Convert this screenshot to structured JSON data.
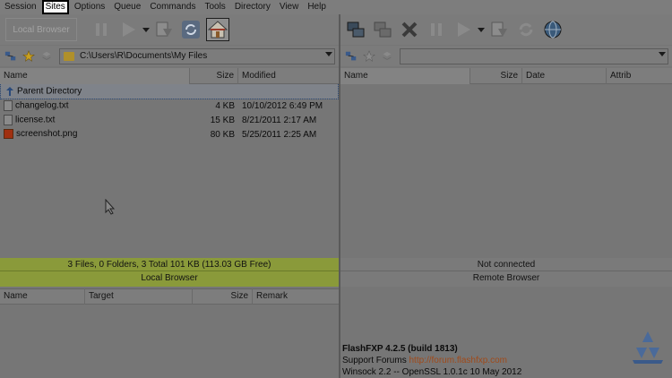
{
  "menu": [
    "Session",
    "Sites",
    "Options",
    "Queue",
    "Commands",
    "Tools",
    "Directory",
    "View",
    "Help"
  ],
  "menu_active_index": 1,
  "local": {
    "toolbar": {
      "browser_label": "Local Browser"
    },
    "path": "C:\\Users\\R\\Documents\\My Files",
    "columns": [
      "Name",
      "Size",
      "Modified"
    ],
    "rows": [
      {
        "name": "Parent Directory",
        "size": "",
        "modified": "",
        "type": "parent"
      },
      {
        "name": "changelog.txt",
        "size": "4 KB",
        "modified": "10/10/2012 6:49 PM",
        "type": "file"
      },
      {
        "name": "license.txt",
        "size": "15 KB",
        "modified": "8/21/2011 2:17 AM",
        "type": "file"
      },
      {
        "name": "screenshot.png",
        "size": "80 KB",
        "modified": "5/25/2011 2:25 AM",
        "type": "image"
      }
    ],
    "status": {
      "summary": "3 Files, 0 Folders, 3 Total 101 KB (113.03 GB Free)",
      "label": "Local Browser"
    }
  },
  "remote": {
    "path": "",
    "columns": [
      "Name",
      "Size",
      "Date",
      "Attrib"
    ],
    "status": {
      "summary": "Not connected",
      "label": "Remote Browser"
    }
  },
  "queue": {
    "columns": [
      "Name",
      "Target",
      "Size",
      "Remark"
    ]
  },
  "log": {
    "version_line": "FlashFXP 4.2.5 (build 1813)",
    "support_prefix": "Support Forums ",
    "support_link": "http://forum.flashfxp.com",
    "winsock_line": "Winsock 2.2 -- OpenSSL 1.0.1c 10 May 2012"
  },
  "colors": {
    "status_local_bg": "#8a9a3a",
    "link": "#a04a1a",
    "selected_menu_outline": "#000000"
  }
}
